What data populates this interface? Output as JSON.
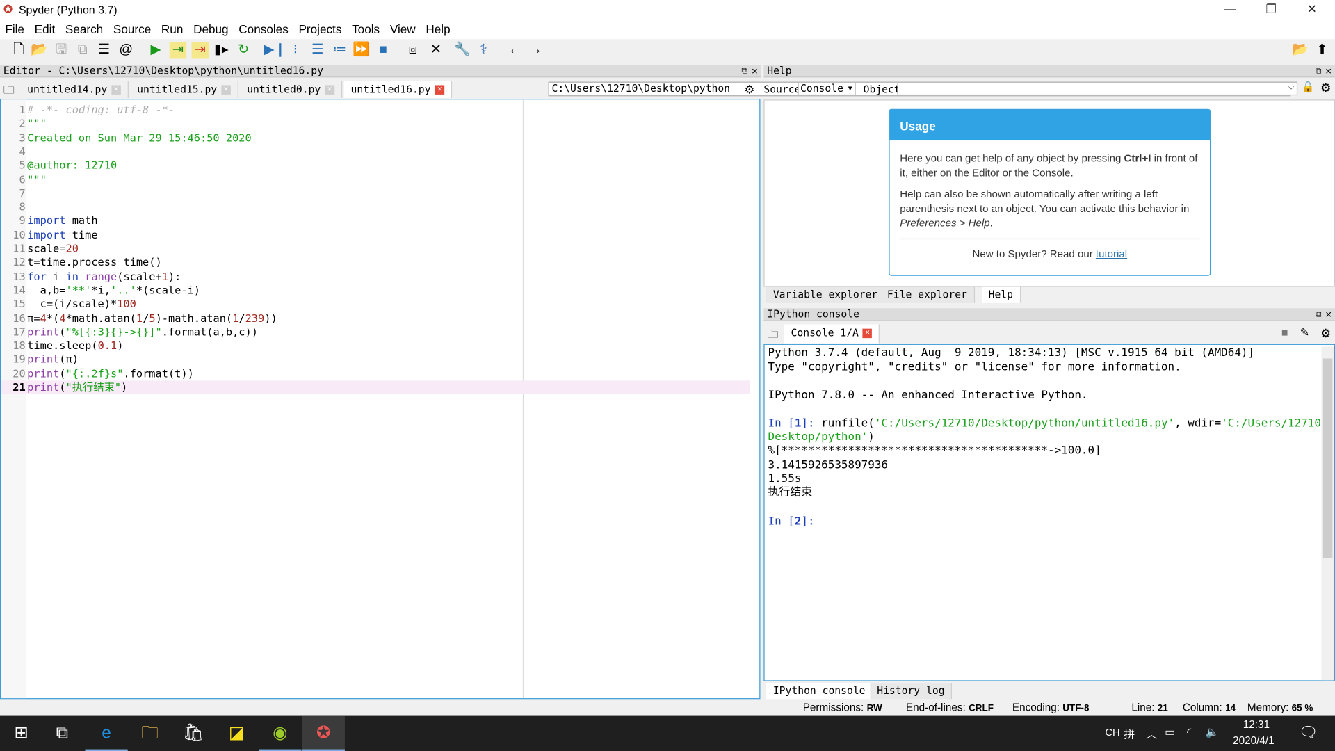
{
  "window": {
    "title": "Spyder (Python 3.7)",
    "minimize": "—",
    "maximize": "❐",
    "close": "✕"
  },
  "menu": [
    "File",
    "Edit",
    "Search",
    "Source",
    "Run",
    "Debug",
    "Consoles",
    "Projects",
    "Tools",
    "View",
    "Help"
  ],
  "toolbar": {
    "path": "C:\\Users\\12710\\Desktop\\python",
    "icons": [
      "new-file",
      "open-file",
      "save",
      "save-all",
      "outline",
      "at",
      "run",
      "run-cell",
      "run-cell-advance",
      "run-selection",
      "re-run",
      "debug",
      "step",
      "step-into",
      "step-return",
      "continue",
      "stop",
      "maximize-pane",
      "fullscreen",
      "preferences",
      "python-path",
      "back",
      "forward",
      "browse",
      "parent-dir"
    ]
  },
  "editor": {
    "title": "Editor - C:\\Users\\12710\\Desktop\\python\\untitled16.py",
    "tabs": [
      {
        "label": "untitled14.py"
      },
      {
        "label": "untitled15.py"
      },
      {
        "label": "untitled0.py"
      },
      {
        "label": "untitled16.py",
        "active": true
      }
    ],
    "current_line": 21,
    "lines": [
      [
        [
          "# -*- coding: utf-8 -*-",
          "cmt"
        ]
      ],
      [
        [
          "\"\"\"",
          "str"
        ]
      ],
      [
        [
          "Created on Sun Mar 29 15:46:50 2020",
          "str"
        ]
      ],
      [
        [
          "",
          "str"
        ]
      ],
      [
        [
          "@author: 12710",
          "str"
        ]
      ],
      [
        [
          "\"\"\"",
          "str"
        ]
      ],
      [],
      [],
      [
        [
          "import",
          "kw"
        ],
        [
          " math",
          ""
        ]
      ],
      [
        [
          "import",
          "kw"
        ],
        [
          " time",
          ""
        ]
      ],
      [
        [
          "scale=",
          ""
        ],
        [
          "20",
          "num"
        ]
      ],
      [
        [
          "t=time.process_time()",
          ""
        ]
      ],
      [
        [
          "for",
          "kw"
        ],
        [
          " i ",
          ""
        ],
        [
          "in",
          "kw"
        ],
        [
          " ",
          ""
        ],
        [
          "range",
          "bi"
        ],
        [
          "(scale+",
          ""
        ],
        [
          "1",
          "num"
        ],
        [
          "):",
          ""
        ]
      ],
      [
        [
          "  a,b=",
          ""
        ],
        [
          "'**'",
          "str"
        ],
        [
          "*i,",
          ""
        ],
        [
          "'..'",
          "str"
        ],
        [
          "*(scale-i)",
          ""
        ]
      ],
      [
        [
          "  c=(i/scale)*",
          ""
        ],
        [
          "100",
          "num"
        ]
      ],
      [
        [
          "π=",
          ""
        ],
        [
          "4",
          "num"
        ],
        [
          "*(",
          ""
        ],
        [
          "4",
          "num"
        ],
        [
          "*math.atan(",
          ""
        ],
        [
          "1",
          "num"
        ],
        [
          "/",
          ""
        ],
        [
          "5",
          "num"
        ],
        [
          ")-math.atan(",
          ""
        ],
        [
          "1",
          "num"
        ],
        [
          "/",
          ""
        ],
        [
          "239",
          "num"
        ],
        [
          "))",
          ""
        ]
      ],
      [
        [
          "print",
          "bi"
        ],
        [
          "(",
          ""
        ],
        [
          "\"%[{:3}{}->{}]\"",
          "str"
        ],
        [
          ".format(a,b,c))",
          ""
        ]
      ],
      [
        [
          "time.sleep(",
          ""
        ],
        [
          "0.1",
          "num"
        ],
        [
          ")",
          ""
        ]
      ],
      [
        [
          "print",
          "bi"
        ],
        [
          "(π)",
          ""
        ]
      ],
      [
        [
          "print",
          "bi"
        ],
        [
          "(",
          ""
        ],
        [
          "\"{:.2f}s\"",
          "str"
        ],
        [
          ".format(t))",
          ""
        ]
      ],
      [
        [
          "print",
          "bi"
        ],
        [
          "(",
          ""
        ],
        [
          "\"执行结束\"",
          "str"
        ],
        [
          ")",
          ""
        ]
      ]
    ]
  },
  "help": {
    "title": "Help",
    "source_label": "Source",
    "source_value": "Console",
    "object_label": "Object",
    "object_value": "",
    "usage_title": "Usage",
    "p1a": "Here you can get help of any object by pressing ",
    "p1b": "Ctrl+I",
    "p1c": " in front of it, either on the Editor or the Console.",
    "p2a": "Help can also be shown automatically after writing a left parenthesis next to an object. You can activate this behavior in ",
    "p2b": "Preferences > Help",
    "p2c": ".",
    "p3": "New to Spyder? Read our ",
    "link": "tutorial",
    "tabs": [
      "Variable explorer",
      "File explorer",
      "Help"
    ]
  },
  "console": {
    "title": "IPython console",
    "tab": "Console 1/A",
    "banner1": "Python 3.7.4 (default, Aug  9 2019, 18:34:13) [MSC v.1915 64 bit (AMD64)]",
    "banner2": "Type \"copyright\", \"credits\" or \"license\" for more information.",
    "banner3": "IPython 7.8.0 -- An enhanced Interactive Python.",
    "in1_prompt": "In [",
    "in1_num": "1",
    "prompt_end": "]: ",
    "cmd_a": "runfile(",
    "cmd_b": "'C:/Users/12710/Desktop/python/untitled16.py'",
    "cmd_c": ", wdir=",
    "cmd_d": "'C:/Users/12710/",
    "cmd_e": "Desktop/python'",
    "cmd_f": ")",
    "out1": "%[****************************************->100.0]",
    "out2": "3.1415926535897936",
    "out3": "1.55s",
    "out4": "执行结束",
    "in2_num": "2",
    "bottom_tabs": [
      "IPython console",
      "History log"
    ]
  },
  "status": {
    "permissions_label": "Permissions:",
    "permissions": "RW",
    "eol_label": "End-of-lines:",
    "eol": "CRLF",
    "encoding_label": "Encoding:",
    "encoding": "UTF-8",
    "line_label": "Line:",
    "line": "21",
    "column_label": "Column:",
    "column": "14",
    "memory_label": "Memory:",
    "memory": "65 %"
  },
  "taskbar": {
    "lang": "CH",
    "ime": "拼",
    "time": "12:31",
    "date": "2020/4/1"
  }
}
